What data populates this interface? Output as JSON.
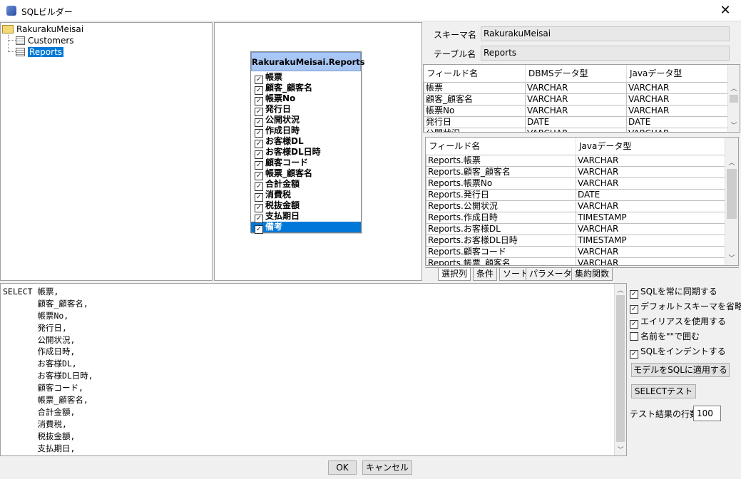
{
  "window": {
    "title": "SQLビルダー",
    "close": "✕"
  },
  "tree": {
    "root": "RakurakuMeisai",
    "children": [
      "Customers",
      "Reports"
    ],
    "selected": "Reports"
  },
  "entity": {
    "title": "RakurakuMeisai.Reports",
    "fields": [
      "帳票",
      "顧客_顧客名",
      "帳票No",
      "発行日",
      "公開状況",
      "作成日時",
      "お客様DL",
      "お客様DL日時",
      "顧客コード",
      "帳票_顧客名",
      "合計金額",
      "消費税",
      "税抜金額",
      "支払期日",
      "備考"
    ],
    "selected": "備考"
  },
  "schema": {
    "schema_label": "スキーマ名",
    "schema_value": "RakurakuMeisai",
    "table_label": "テーブル名",
    "table_value": "Reports"
  },
  "fields_table": {
    "headers": [
      "フィールド名",
      "DBMSデータ型",
      "Javaデータ型"
    ],
    "rows": [
      [
        "帳票",
        "VARCHAR",
        "VARCHAR"
      ],
      [
        "顧客_顧客名",
        "VARCHAR",
        "VARCHAR"
      ],
      [
        "帳票No",
        "VARCHAR",
        "VARCHAR"
      ],
      [
        "発行日",
        "DATE",
        "DATE"
      ],
      [
        "公開状況",
        "VARCHAR",
        "VARCHAR"
      ]
    ]
  },
  "select_table": {
    "headers": [
      "フィールド名",
      "Javaデータ型"
    ],
    "rows": [
      [
        "Reports.帳票",
        "VARCHAR"
      ],
      [
        "Reports.顧客_顧客名",
        "VARCHAR"
      ],
      [
        "Reports.帳票No",
        "VARCHAR"
      ],
      [
        "Reports.発行日",
        "DATE"
      ],
      [
        "Reports.公開状況",
        "VARCHAR"
      ],
      [
        "Reports.作成日時",
        "TIMESTAMP"
      ],
      [
        "Reports.お客様DL",
        "VARCHAR"
      ],
      [
        "Reports.お客様DL日時",
        "TIMESTAMP"
      ],
      [
        "Reports.顧客コード",
        "VARCHAR"
      ],
      [
        "Reports.帳票_顧客名",
        "VARCHAR"
      ]
    ]
  },
  "tabs": [
    "選択列",
    "条件",
    "ソート",
    "パラメーター",
    "集約関数"
  ],
  "sql": [
    "SELECT 帳票,",
    "       顧客_顧客名,",
    "       帳票No,",
    "       発行日,",
    "       公開状況,",
    "       作成日時,",
    "       お客様DL,",
    "       お客様DL日時,",
    "       顧客コード,",
    "       帳票_顧客名,",
    "       合計金額,",
    "       消費税,",
    "       税抜金額,",
    "       支払期日,"
  ],
  "options": [
    {
      "label": "SQLを常に同期する",
      "checked": true
    },
    {
      "label": "デフォルトスキーマを省略する",
      "checked": true
    },
    {
      "label": "エイリアスを使用する",
      "checked": true
    },
    {
      "label": "名前を\"\"で囲む",
      "checked": false
    },
    {
      "label": "SQLをインデントする",
      "checked": true
    }
  ],
  "buttons": {
    "apply": "モデルをSQLに適用する",
    "select_test": "SELECTテスト",
    "ok": "OK",
    "cancel": "キャンセル"
  },
  "rowcount": {
    "label": "テスト結果の行数",
    "value": "100"
  }
}
